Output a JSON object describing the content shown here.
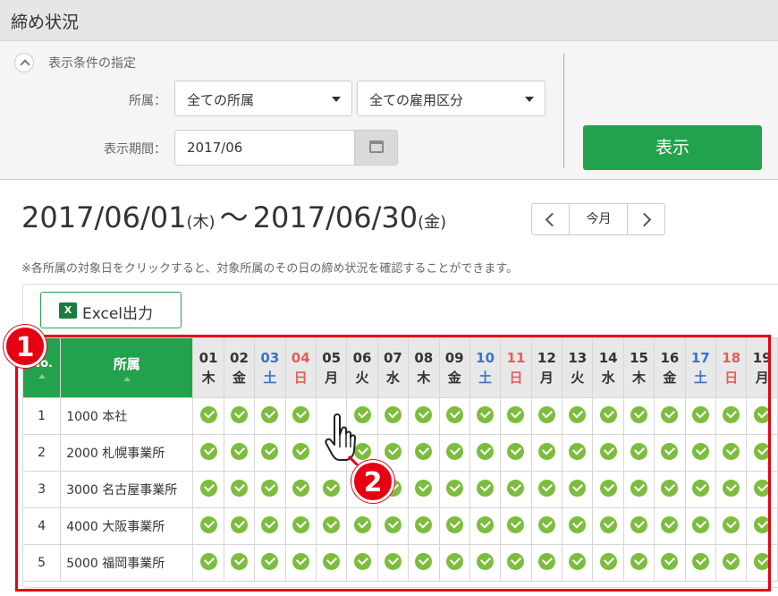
{
  "header": {
    "title": "締め状況"
  },
  "filter": {
    "section_label": "表示条件の指定",
    "dept_label": "所属：",
    "dept_select": "全ての所属",
    "employment_select": "全ての雇用区分",
    "period_label": "表示期間：",
    "period_value": "2017/06",
    "show_button": "表示"
  },
  "range": {
    "start": "2017/06/01",
    "start_dow": "(木)",
    "sep": "～",
    "end": "2017/06/30",
    "end_dow": "(金)",
    "today_button": "今月"
  },
  "note": "※各所属の対象日をクリックすると、対象所属のその日の締め状況を確認することができます。",
  "excel_button": "Excel出力",
  "excel_icon_letter": "X",
  "table": {
    "no_header": "No.",
    "dept_header": "所属",
    "days": [
      {
        "d": "01",
        "w": "木",
        "t": ""
      },
      {
        "d": "02",
        "w": "金",
        "t": ""
      },
      {
        "d": "03",
        "w": "土",
        "t": "sat"
      },
      {
        "d": "04",
        "w": "日",
        "t": "sun"
      },
      {
        "d": "05",
        "w": "月",
        "t": ""
      },
      {
        "d": "06",
        "w": "火",
        "t": ""
      },
      {
        "d": "07",
        "w": "水",
        "t": ""
      },
      {
        "d": "08",
        "w": "木",
        "t": ""
      },
      {
        "d": "09",
        "w": "金",
        "t": ""
      },
      {
        "d": "10",
        "w": "土",
        "t": "sat"
      },
      {
        "d": "11",
        "w": "日",
        "t": "sun"
      },
      {
        "d": "12",
        "w": "月",
        "t": ""
      },
      {
        "d": "13",
        "w": "火",
        "t": ""
      },
      {
        "d": "14",
        "w": "水",
        "t": ""
      },
      {
        "d": "15",
        "w": "木",
        "t": ""
      },
      {
        "d": "16",
        "w": "金",
        "t": ""
      },
      {
        "d": "17",
        "w": "土",
        "t": "sat"
      },
      {
        "d": "18",
        "w": "日",
        "t": "sun"
      },
      {
        "d": "19",
        "w": "月",
        "t": ""
      }
    ],
    "rows": [
      {
        "no": "1",
        "dept": "1000  本社",
        "blank": [
          4
        ]
      },
      {
        "no": "2",
        "dept": "2000  札幌事業所",
        "blank": [
          4
        ]
      },
      {
        "no": "3",
        "dept": "3000  名古屋事業所",
        "blank": []
      },
      {
        "no": "4",
        "dept": "4000  大阪事業所",
        "blank": []
      },
      {
        "no": "5",
        "dept": "5000  福岡事業所",
        "blank": []
      }
    ],
    "status_icon": "check-circle-icon",
    "colors": {
      "header_green": "#23a24d",
      "check_green": "#7cbd3d",
      "sat_blue": "#3c72c8",
      "sun_red": "#e45c5c"
    }
  },
  "annotations": {
    "badge1": "1",
    "badge2": "2",
    "color": "#e60012"
  }
}
